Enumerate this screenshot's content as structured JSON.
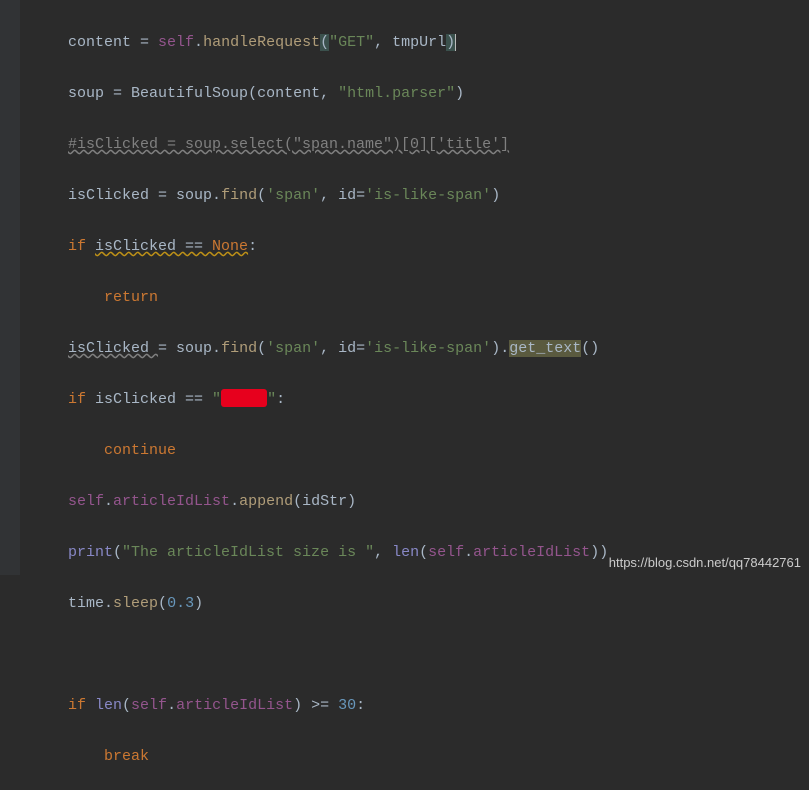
{
  "lines": {
    "l1": {
      "a": "content ",
      "op": "= ",
      "self": "self",
      "dot1": ".",
      "fn": "handleRequest",
      "open": "(",
      "s1": "\"GET\"",
      "comma": ", ",
      "arg": "tmpUrl",
      "close": ")"
    },
    "l2": {
      "a": "soup ",
      "op": "= ",
      "fn": "BeautifulSoup",
      "open": "(",
      "arg": "content",
      "comma": ", ",
      "s1": "\"html.parser\"",
      "close": ")"
    },
    "l3": {
      "text": "#isClicked = soup.select(\"span.name\")[0]['title']"
    },
    "l4": {
      "a": "isClicked ",
      "op": "= ",
      "obj": "soup",
      "dot": ".",
      "fn": "find",
      "open": "(",
      "s1": "'span'",
      "comma": ", ",
      "kwarg": "id",
      "eq": "=",
      "s2": "'is-like-span'",
      "close": ")"
    },
    "l5": {
      "kw": "if ",
      "a": "isClicked ",
      "op": "== ",
      "none": "None",
      "colon": ":"
    },
    "l6": {
      "kw": "return"
    },
    "l7": {
      "a": "isClicked ",
      "op": "= ",
      "obj": "soup",
      "dot": ".",
      "fn": "find",
      "open": "(",
      "s1": "'span'",
      "comma": ", ",
      "kwarg": "id",
      "eq": "=",
      "s2": "'is-like-span'",
      "close": ")",
      "dot2": ".",
      "gt": "get_text",
      "p": "()"
    },
    "l8": {
      "kw": "if ",
      "a": "isClicked ",
      "op": "== ",
      "q1": "\"",
      "q2": "\"",
      "colon": ":"
    },
    "l9": {
      "kw": "continue"
    },
    "l10": {
      "self": "self",
      "dot": ".",
      "attr": "articleIdList",
      "dot2": ".",
      "fn": "append",
      "open": "(",
      "arg": "idStr",
      "close": ")"
    },
    "l11": {
      "fn": "print",
      "open": "(",
      "s1": "\"The articleIdList size is \"",
      "comma": ", ",
      "len": "len",
      "p1": "(",
      "self": "self",
      "dot": ".",
      "attr": "articleIdList",
      "p2": "))"
    },
    "l12": {
      "obj": "time",
      "dot": ".",
      "fn": "sleep",
      "open": "(",
      "num": "0.3",
      "close": ")"
    },
    "l13": {
      "kw": "if ",
      "len": "len",
      "p1": "(",
      "self": "self",
      "dot": ".",
      "attr": "articleIdList",
      "p2": ") ",
      "op": ">= ",
      "num": "30",
      "colon": ":"
    },
    "l14": {
      "kw": "break"
    }
  },
  "watermark": "https://blog.csdn.net/qq78442761"
}
